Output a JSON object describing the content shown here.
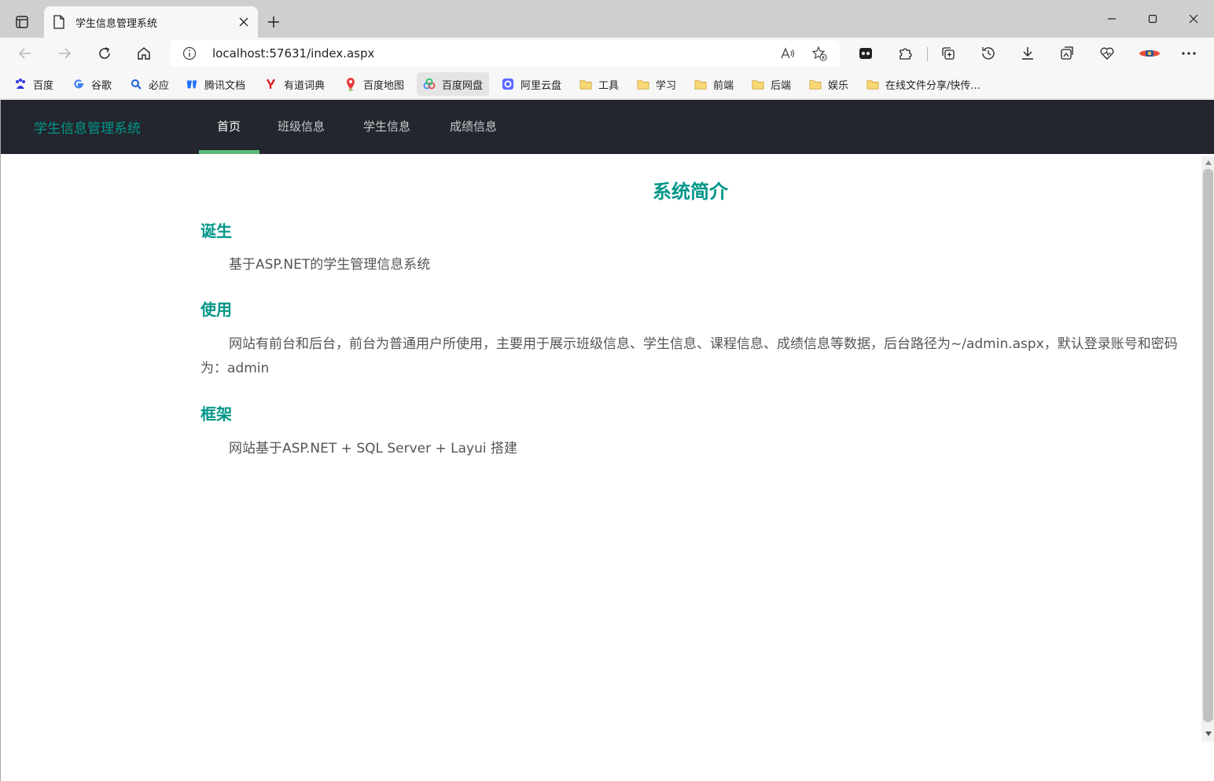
{
  "browser": {
    "tab": {
      "title": "学生信息管理系统"
    },
    "address": {
      "url": "localhost:57631/index.aspx"
    },
    "bookmarks": [
      {
        "label": "百度",
        "icon": "baidu-icon"
      },
      {
        "label": "谷歌",
        "icon": "google-icon"
      },
      {
        "label": "必应",
        "icon": "bing-search-icon"
      },
      {
        "label": "腾讯文档",
        "icon": "tencent-docs-icon"
      },
      {
        "label": "有道词典",
        "icon": "youdao-icon"
      },
      {
        "label": "百度地图",
        "icon": "map-pin-icon"
      },
      {
        "label": "百度网盘",
        "icon": "baidu-netdisk-icon"
      },
      {
        "label": "阿里云盘",
        "icon": "aliyun-drive-icon"
      },
      {
        "label": "工具",
        "icon": "folder-icon"
      },
      {
        "label": "学习",
        "icon": "folder-icon"
      },
      {
        "label": "前端",
        "icon": "folder-icon"
      },
      {
        "label": "后端",
        "icon": "folder-icon"
      },
      {
        "label": "娱乐",
        "icon": "folder-icon"
      },
      {
        "label": "在线文件分享/快传...",
        "icon": "folder-icon"
      }
    ]
  },
  "site": {
    "brand": "学生信息管理系统",
    "nav": [
      {
        "label": "首页",
        "active": true
      },
      {
        "label": "班级信息",
        "active": false
      },
      {
        "label": "学生信息",
        "active": false
      },
      {
        "label": "成绩信息",
        "active": false
      }
    ],
    "accent": "#009688",
    "nav_bg": "#23262e",
    "nav_active_bar": "#5fb878"
  },
  "content": {
    "title": "系统简介",
    "sections": [
      {
        "heading": "诞生",
        "text": "基于ASP.NET的学生管理信息系统"
      },
      {
        "heading": "使用",
        "text": "网站有前台和后台，前台为普通用户所使用，主要用于展示班级信息、学生信息、课程信息、成绩信息等数据，后台路径为~/admin.aspx，默认登录账号和密码为：admin"
      },
      {
        "heading": "框架",
        "text": "网站基于ASP.NET + SQL Server + Layui 搭建"
      }
    ]
  }
}
